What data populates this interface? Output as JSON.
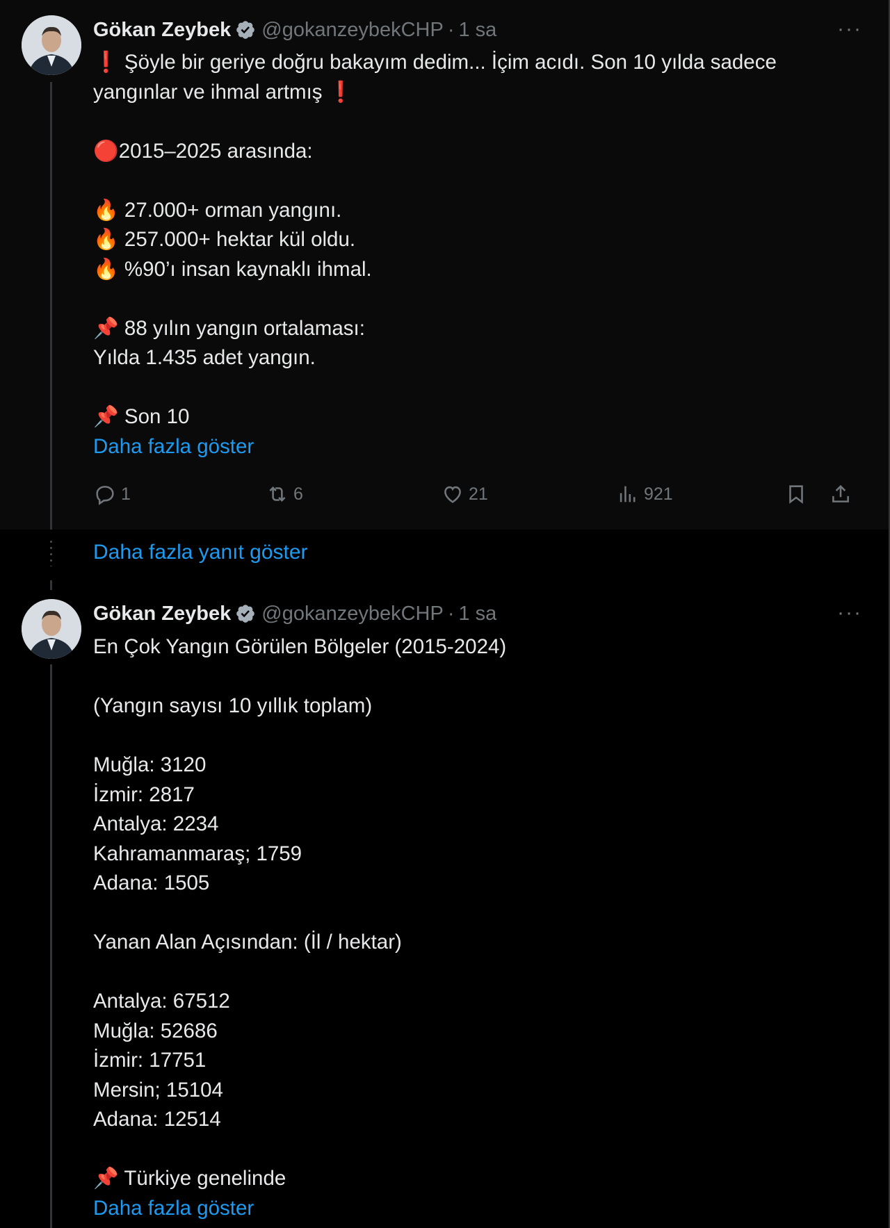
{
  "colors": {
    "link": "#1d9bf0",
    "muted": "#71767b",
    "text": "#e7e9ea",
    "verified": "#a6b0b9"
  },
  "tweet1": {
    "author_name": "Gökan Zeybek",
    "handle": "@gokanzeybekCHP",
    "separator": "·",
    "time": "1 sa",
    "more": "···",
    "lines": [
      "❗ Şöyle bir geriye doğru bakayım dedim... İçim acıdı. Son 10 yılda sadece",
      "yangınlar ve ihmal artmış ❗",
      "",
      "🔴2015–2025 arasında:",
      "",
      "🔥 27.000+ orman yangını.",
      "🔥 257.000+ hektar kül oldu.",
      "🔥 %90’ı insan kaynaklı ihmal.",
      "",
      "📌 88 yılın yangın ortalaması:",
      "Yılda 1.435 adet yangın.",
      "",
      "📌 Son 10"
    ],
    "show_more": "Daha fazla göster",
    "actions": {
      "replies": "1",
      "reposts": "6",
      "likes": "21",
      "views": "921"
    }
  },
  "show_more_replies": "Daha fazla yanıt göster",
  "tweet2": {
    "author_name": "Gökan Zeybek",
    "handle": "@gokanzeybekCHP",
    "separator": "·",
    "time": "1 sa",
    "more": "···",
    "lines": [
      "En Çok Yangın Görülen Bölgeler (2015-2024)",
      "",
      "(Yangın sayısı 10 yıllık toplam)",
      "",
      "Muğla: 3120",
      "İzmir: 2817",
      "Antalya: 2234",
      "Kahramanmaraş; 1759",
      "Adana: 1505",
      "",
      "Yanan Alan Açısından: (İl / hektar)",
      "",
      "Antalya: 67512",
      "Muğla: 52686",
      "İzmir: 17751",
      "Mersin; 15104",
      "Adana: 12514",
      "",
      "📌 Türkiye genelinde"
    ],
    "show_more": "Daha fazla göster"
  }
}
